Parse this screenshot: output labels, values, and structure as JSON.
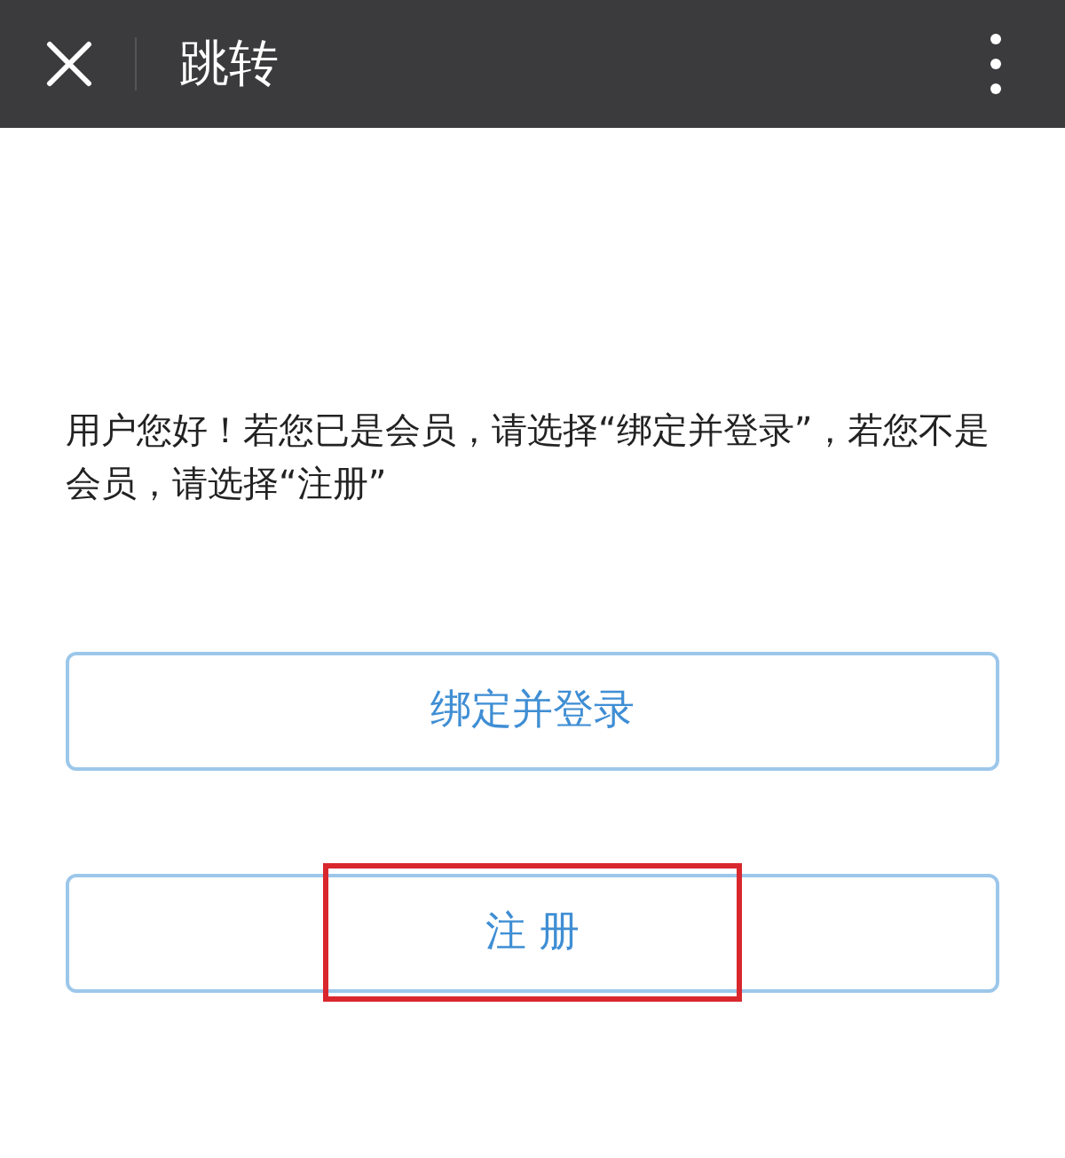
{
  "header": {
    "title": "跳转"
  },
  "message": "用户您好！若您已是会员，请选择“绑定并登录”，若您不是会员，请选择“注册”",
  "buttons": [
    {
      "label": "绑定并登录",
      "highlighted": false
    },
    {
      "label": "注 册",
      "highlighted": true
    }
  ]
}
